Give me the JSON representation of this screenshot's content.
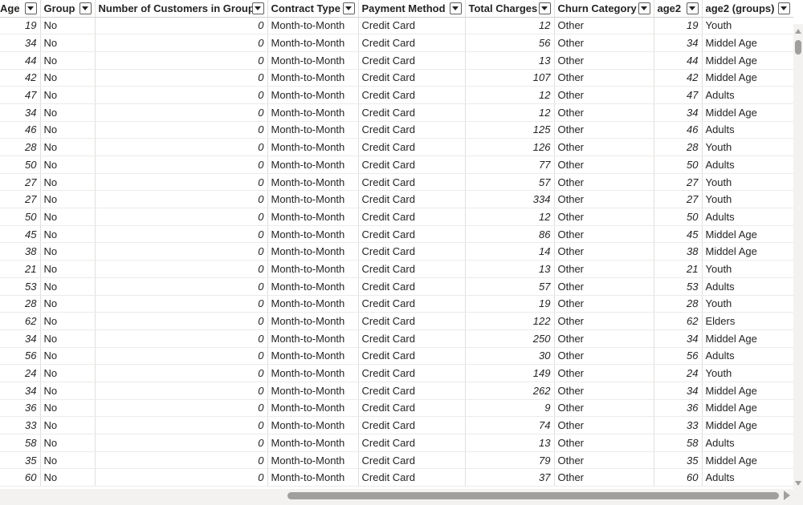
{
  "headers": [
    "Age",
    "Group",
    "Number of Customers in Group",
    "Contract Type",
    "Payment Method",
    "Total Charges",
    "Churn Category",
    "age2",
    "age2 (groups)"
  ],
  "rows": [
    [
      "19",
      "No",
      "0",
      "Month-to-Month",
      "Credit Card",
      "12",
      "Other",
      "19",
      "Youth"
    ],
    [
      "34",
      "No",
      "0",
      "Month-to-Month",
      "Credit Card",
      "56",
      "Other",
      "34",
      "Middel Age"
    ],
    [
      "44",
      "No",
      "0",
      "Month-to-Month",
      "Credit Card",
      "13",
      "Other",
      "44",
      "Middel Age"
    ],
    [
      "42",
      "No",
      "0",
      "Month-to-Month",
      "Credit Card",
      "107",
      "Other",
      "42",
      "Middel Age"
    ],
    [
      "47",
      "No",
      "0",
      "Month-to-Month",
      "Credit Card",
      "12",
      "Other",
      "47",
      "Adults"
    ],
    [
      "34",
      "No",
      "0",
      "Month-to-Month",
      "Credit Card",
      "12",
      "Other",
      "34",
      "Middel Age"
    ],
    [
      "46",
      "No",
      "0",
      "Month-to-Month",
      "Credit Card",
      "125",
      "Other",
      "46",
      "Adults"
    ],
    [
      "28",
      "No",
      "0",
      "Month-to-Month",
      "Credit Card",
      "126",
      "Other",
      "28",
      "Youth"
    ],
    [
      "50",
      "No",
      "0",
      "Month-to-Month",
      "Credit Card",
      "77",
      "Other",
      "50",
      "Adults"
    ],
    [
      "27",
      "No",
      "0",
      "Month-to-Month",
      "Credit Card",
      "57",
      "Other",
      "27",
      "Youth"
    ],
    [
      "27",
      "No",
      "0",
      "Month-to-Month",
      "Credit Card",
      "334",
      "Other",
      "27",
      "Youth"
    ],
    [
      "50",
      "No",
      "0",
      "Month-to-Month",
      "Credit Card",
      "12",
      "Other",
      "50",
      "Adults"
    ],
    [
      "45",
      "No",
      "0",
      "Month-to-Month",
      "Credit Card",
      "86",
      "Other",
      "45",
      "Middel Age"
    ],
    [
      "38",
      "No",
      "0",
      "Month-to-Month",
      "Credit Card",
      "14",
      "Other",
      "38",
      "Middel Age"
    ],
    [
      "21",
      "No",
      "0",
      "Month-to-Month",
      "Credit Card",
      "13",
      "Other",
      "21",
      "Youth"
    ],
    [
      "53",
      "No",
      "0",
      "Month-to-Month",
      "Credit Card",
      "57",
      "Other",
      "53",
      "Adults"
    ],
    [
      "28",
      "No",
      "0",
      "Month-to-Month",
      "Credit Card",
      "19",
      "Other",
      "28",
      "Youth"
    ],
    [
      "62",
      "No",
      "0",
      "Month-to-Month",
      "Credit Card",
      "122",
      "Other",
      "62",
      "Elders"
    ],
    [
      "34",
      "No",
      "0",
      "Month-to-Month",
      "Credit Card",
      "250",
      "Other",
      "34",
      "Middel Age"
    ],
    [
      "56",
      "No",
      "0",
      "Month-to-Month",
      "Credit Card",
      "30",
      "Other",
      "56",
      "Adults"
    ],
    [
      "24",
      "No",
      "0",
      "Month-to-Month",
      "Credit Card",
      "149",
      "Other",
      "24",
      "Youth"
    ],
    [
      "34",
      "No",
      "0",
      "Month-to-Month",
      "Credit Card",
      "262",
      "Other",
      "34",
      "Middel Age"
    ],
    [
      "36",
      "No",
      "0",
      "Month-to-Month",
      "Credit Card",
      "9",
      "Other",
      "36",
      "Middel Age"
    ],
    [
      "33",
      "No",
      "0",
      "Month-to-Month",
      "Credit Card",
      "74",
      "Other",
      "33",
      "Middel Age"
    ],
    [
      "58",
      "No",
      "0",
      "Month-to-Month",
      "Credit Card",
      "13",
      "Other",
      "58",
      "Adults"
    ],
    [
      "35",
      "No",
      "0",
      "Month-to-Month",
      "Credit Card",
      "79",
      "Other",
      "35",
      "Middel Age"
    ],
    [
      "60",
      "No",
      "0",
      "Month-to-Month",
      "Credit Card",
      "37",
      "Other",
      "60",
      "Adults"
    ]
  ],
  "numeric_columns": [
    0,
    2,
    5,
    7
  ],
  "icons": {
    "filter": "chevron-down-filter-icon",
    "scroll_up": "scroll-up-arrow-icon",
    "scroll_down": "scroll-down-arrow-icon",
    "scroll_right": "scroll-right-arrow-icon"
  },
  "colors": {
    "grid_line": "#e1dfdd",
    "scrollbar_track": "#f3f2f1",
    "scrollbar_thumb": "#a19f9d",
    "text": "#252423"
  }
}
